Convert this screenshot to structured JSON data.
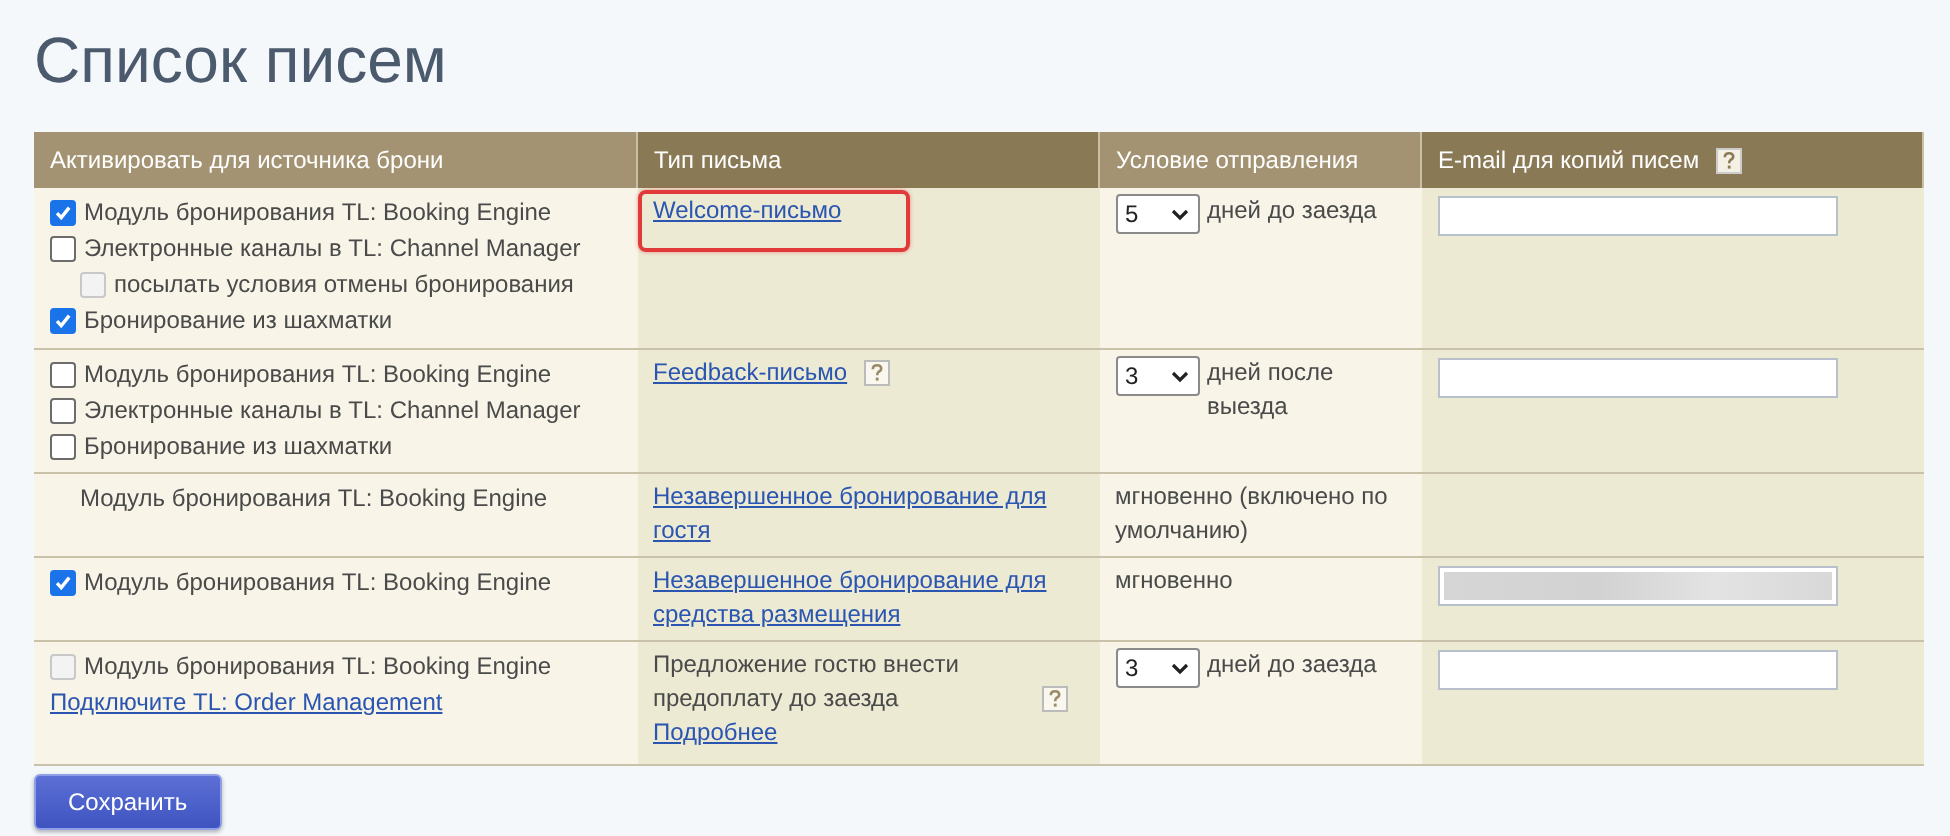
{
  "title": "Список писем",
  "columns": [
    {
      "label": "Активировать для источника брони",
      "help": false
    },
    {
      "label": "Тип письма",
      "help": false
    },
    {
      "label": "Условие отправления",
      "help": false
    },
    {
      "label": "E-mail для копий писем",
      "help": true
    }
  ],
  "rows": [
    {
      "sources": [
        {
          "kind": "checkbox",
          "label": "Модуль бронирования TL: Booking Engine",
          "checked": true,
          "disabled": false
        },
        {
          "kind": "checkbox",
          "label": "Электронные каналы в TL: Channel Manager",
          "checked": false,
          "disabled": false,
          "children": [
            {
              "kind": "checkbox",
              "label": "посылать условия отмены бронирования",
              "checked": false,
              "disabled": true
            }
          ]
        },
        {
          "kind": "checkbox",
          "label": "Бронирование из шахматки",
          "checked": true,
          "disabled": false
        }
      ],
      "letter": {
        "kind": "link",
        "text": "Welcome-письмо",
        "help": false,
        "highlighted": true
      },
      "condition": {
        "kind": "select",
        "value": "5",
        "text": "дней  до заезда"
      },
      "email": {
        "kind": "input"
      }
    },
    {
      "sources": [
        {
          "kind": "checkbox",
          "label": "Модуль бронирования TL: Booking Engine",
          "checked": false,
          "disabled": false
        },
        {
          "kind": "checkbox",
          "label": "Электронные каналы в TL: Channel Manager",
          "checked": false,
          "disabled": false
        },
        {
          "kind": "checkbox",
          "label": "Бронирование из шахматки",
          "checked": false,
          "disabled": false
        }
      ],
      "letter": {
        "kind": "link",
        "text": "Feedback-письмо",
        "help": true,
        "highlighted": false
      },
      "condition": {
        "kind": "select",
        "value": "3",
        "text": "дней после выезда"
      },
      "email": {
        "kind": "input"
      }
    },
    {
      "sources": [
        {
          "kind": "plain",
          "label": "Модуль бронирования TL: Booking Engine"
        }
      ],
      "letter": {
        "kind": "link",
        "text": "Незавершенное бронирование для гостя",
        "help": false,
        "highlighted": false
      },
      "condition": {
        "kind": "text",
        "text": "мгновенно (включено по умолчанию)"
      },
      "email": {
        "kind": "none"
      }
    },
    {
      "sources": [
        {
          "kind": "checkbox",
          "label": "Модуль бронирования TL: Booking Engine",
          "checked": true,
          "disabled": false
        }
      ],
      "letter": {
        "kind": "link",
        "text": "Незавершенное бронирование для средства размещения",
        "help": false,
        "highlighted": false
      },
      "condition": {
        "kind": "text",
        "text": "мгновенно"
      },
      "email": {
        "kind": "blurred"
      }
    },
    {
      "sources": [
        {
          "kind": "checkbox",
          "label": "Модуль бронирования TL: Booking Engine",
          "checked": false,
          "disabled": true
        },
        {
          "kind": "link",
          "label": "Подключите TL: Order Management"
        }
      ],
      "letter": {
        "kind": "text",
        "text": "Предложение гостю внести предоплату до заезда",
        "help": true,
        "highlighted": false,
        "more_link": "Подробнее"
      },
      "condition": {
        "kind": "select",
        "value": "3",
        "text": "дней  до заезда"
      },
      "email": {
        "kind": "input"
      }
    }
  ],
  "save_button": "Сохранить"
}
